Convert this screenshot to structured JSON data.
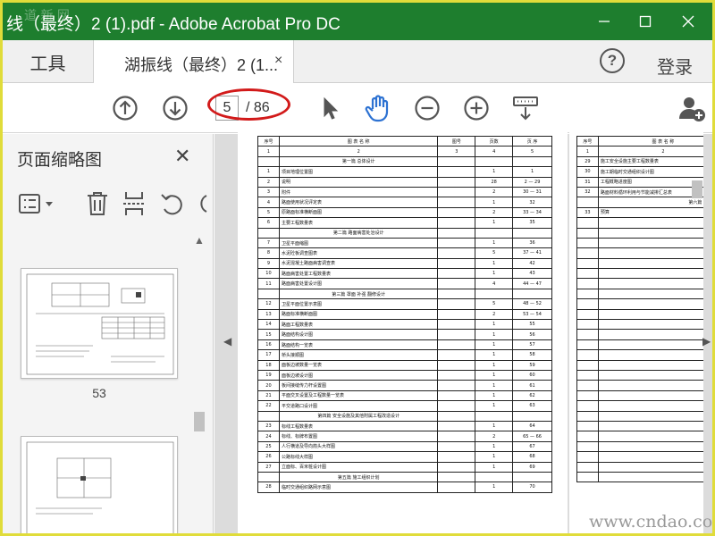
{
  "window": {
    "title": "线（最终）2 (1).pdf - Adobe Acrobat Pro DC",
    "watermark_top": "道 新 网"
  },
  "tabs": {
    "tools_label": "工具",
    "doc_label": "湖振线（最终）2 (1...",
    "close_glyph": "×",
    "help_glyph": "?",
    "login_label": "登录"
  },
  "toolbar": {
    "current_page": "5",
    "total_pages": "/ 86",
    "icons": [
      "prev-page-icon",
      "next-page-icon",
      "select-arrow-icon",
      "hand-tool-icon",
      "zoom-out-icon",
      "zoom-in-icon",
      "keyboard-icon",
      "add-user-icon"
    ]
  },
  "sidebar": {
    "title": "页面缩略图",
    "close_glyph": "✕",
    "thumbnails": [
      {
        "label": "53"
      },
      {
        "label": ""
      }
    ]
  },
  "document": {
    "headers": [
      "序号",
      "图 表 名 称",
      "图号",
      "页数",
      "页 序"
    ],
    "numbers_row": [
      "1",
      "2",
      "3",
      "4",
      "5"
    ],
    "rows": [
      {
        "t": "sec",
        "name": "第一篇  总体设计"
      },
      {
        "n": "1",
        "name": "项目地理位置图",
        "p": "1",
        "s": "1"
      },
      {
        "n": "2",
        "name": "说明",
        "p": "28",
        "s": "2  —  29"
      },
      {
        "n": "3",
        "name": "附件",
        "p": "2",
        "s": "30  —  31"
      },
      {
        "n": "4",
        "name": "路面使用状况评定表",
        "p": "1",
        "s": "32"
      },
      {
        "n": "5",
        "name": "原路面标准横断面图",
        "p": "2",
        "s": "33  —  34"
      },
      {
        "n": "6",
        "name": "主要工程数量表",
        "p": "1",
        "s": "35"
      },
      {
        "t": "sec",
        "name": "第二篇  路面病害处治设计"
      },
      {
        "n": "7",
        "name": "卫星平面缩图",
        "p": "1",
        "s": "36"
      },
      {
        "n": "8",
        "name": "水泥砼板调查图表",
        "p": "5",
        "s": "37  —  41"
      },
      {
        "n": "9",
        "name": "水泥混凝土路面病害调查表",
        "p": "1",
        "s": "42"
      },
      {
        "n": "10",
        "name": "路面病害处置工程数量表",
        "p": "1",
        "s": "43"
      },
      {
        "n": "11",
        "name": "路面病害处置设计图",
        "p": "4",
        "s": "44  —  47"
      },
      {
        "t": "sec",
        "name": "第三篇  罩面 补强 翻修设计"
      },
      {
        "n": "12",
        "name": "卫星平面位置示意图",
        "p": "5",
        "s": "48  —  52"
      },
      {
        "n": "13",
        "name": "路面标准横断面图",
        "p": "2",
        "s": "53  —  54"
      },
      {
        "n": "14",
        "name": "路面工程数量表",
        "p": "1",
        "s": "55"
      },
      {
        "n": "15",
        "name": "路面结构设计图",
        "p": "1",
        "s": "56"
      },
      {
        "n": "16",
        "name": "路面结构一览表",
        "p": "1",
        "s": "57"
      },
      {
        "n": "17",
        "name": "桥头接顺图",
        "p": "1",
        "s": "58"
      },
      {
        "n": "18",
        "name": "面板边坡数量一览表",
        "p": "1",
        "s": "59"
      },
      {
        "n": "19",
        "name": "面板边坡设计图",
        "p": "1",
        "s": "60"
      },
      {
        "n": "20",
        "name": "板间接缝传力杆设置图",
        "p": "1",
        "s": "61"
      },
      {
        "n": "21",
        "name": "平面交叉设置及工程数量一览表",
        "p": "1",
        "s": "62"
      },
      {
        "n": "22",
        "name": "平交道路口设计图",
        "p": "1",
        "s": "63"
      },
      {
        "t": "sec",
        "name": "第四篇  安全设施及其他附属工程改造设计"
      },
      {
        "n": "23",
        "name": "标线工程数量表",
        "p": "1",
        "s": "64"
      },
      {
        "n": "24",
        "name": "标线、标牌布置图",
        "p": "2",
        "s": "65  —  66"
      },
      {
        "n": "25",
        "name": "人行横道及导向箭头大样图",
        "p": "1",
        "s": "67"
      },
      {
        "n": "26",
        "name": "公路标线大样图",
        "p": "1",
        "s": "68"
      },
      {
        "n": "27",
        "name": "立面标、百米桩设计图",
        "p": "1",
        "s": "69"
      },
      {
        "t": "sec",
        "name": "第五篇  施工组织计划"
      },
      {
        "n": "28",
        "name": "临时交通组织路网示意图",
        "p": "1",
        "s": "70"
      }
    ],
    "page2_headers": [
      "序号",
      "图 表 名 称"
    ],
    "page2_numbers": [
      "1",
      "2"
    ],
    "page2_rows": [
      {
        "n": "29",
        "name": "施工安全设施主要工程数量表"
      },
      {
        "n": "30",
        "name": "施工期临时交通组织设计图"
      },
      {
        "n": "31",
        "name": "工程概略进度图"
      },
      {
        "n": "32",
        "name": "路面材料循环利用与节能减排汇总表"
      },
      {
        "t": "sec",
        "name": "第六篇  施工图预算"
      },
      {
        "n": "33",
        "name": "预算"
      }
    ]
  },
  "footer": {
    "watermark": "www.cndao.com"
  },
  "colors": {
    "titlebar": "#1e7e2e",
    "frame": "#e0dc3a",
    "highlight_oval": "#d21a1a"
  }
}
